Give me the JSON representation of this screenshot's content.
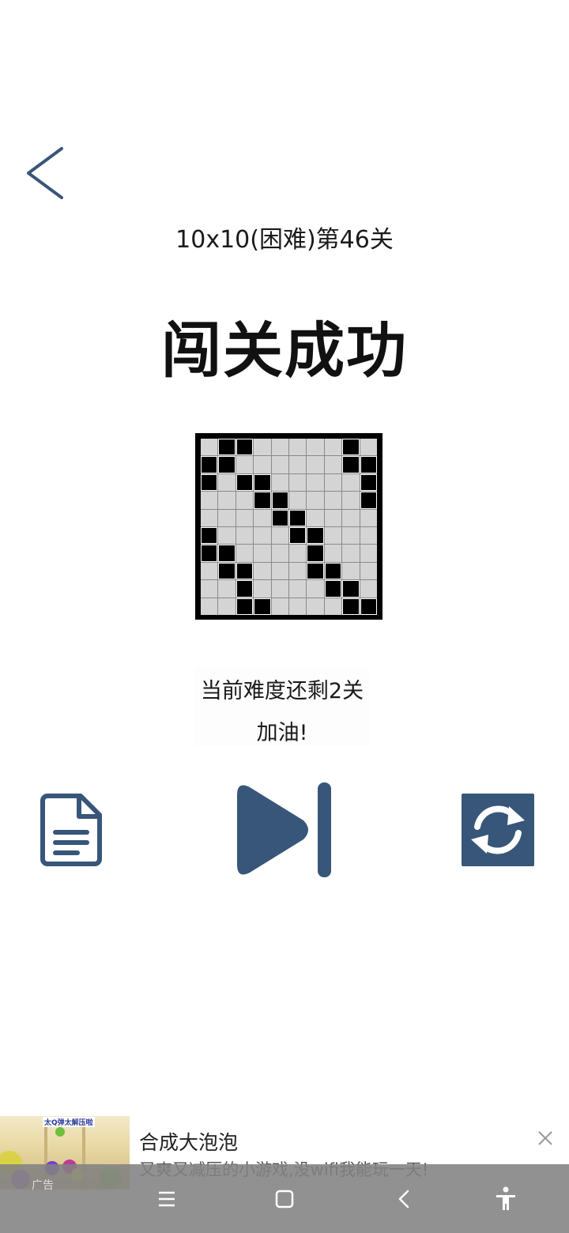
{
  "header": {
    "back_icon": "chevron-left-icon",
    "level_title": "10x10(困难)第46关",
    "result_title": "闯关成功"
  },
  "board": {
    "rows": 10,
    "cols": 10,
    "filled": [
      [
        0,
        1,
        1,
        0,
        0,
        0,
        0,
        0,
        1,
        0
      ],
      [
        1,
        1,
        0,
        0,
        0,
        0,
        0,
        0,
        1,
        1
      ],
      [
        1,
        0,
        1,
        1,
        0,
        0,
        0,
        0,
        0,
        1
      ],
      [
        0,
        0,
        0,
        1,
        1,
        0,
        0,
        0,
        0,
        1
      ],
      [
        0,
        0,
        0,
        0,
        1,
        1,
        0,
        0,
        0,
        0
      ],
      [
        1,
        0,
        0,
        0,
        0,
        1,
        1,
        0,
        0,
        0
      ],
      [
        1,
        1,
        0,
        0,
        0,
        0,
        1,
        0,
        0,
        0
      ],
      [
        0,
        1,
        1,
        0,
        0,
        0,
        1,
        1,
        0,
        0
      ],
      [
        0,
        0,
        1,
        0,
        0,
        0,
        0,
        1,
        1,
        0
      ],
      [
        0,
        0,
        1,
        1,
        0,
        0,
        0,
        0,
        1,
        1
      ]
    ]
  },
  "progress": {
    "remaining_text": "当前难度还剩2关",
    "cheer_text": "加油!"
  },
  "actions": {
    "doc_icon": "document-icon",
    "next_icon": "skip-next-icon",
    "refresh_icon": "refresh-icon"
  },
  "ad": {
    "title": "合成大泡泡",
    "description": "又爽又减压的小游戏,没wifi我能玩一天!",
    "thumb_caption": "太Q弹太解压啦",
    "label": "广告",
    "close_icon": "close-icon"
  },
  "navbar": {
    "items": [
      "menu-icon",
      "home-icon",
      "back-icon",
      "accessibility-icon"
    ]
  },
  "colors": {
    "accent": "#385679",
    "board_border": "#000000",
    "cell_empty": "#d4d4d4",
    "cell_filled": "#000000"
  }
}
